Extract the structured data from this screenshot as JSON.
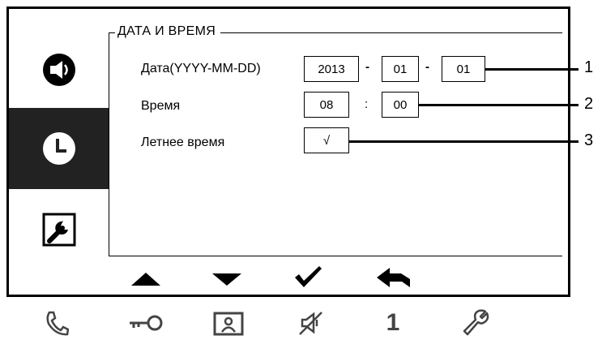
{
  "sidebar": {
    "items": [
      {
        "icon": "speaker-icon",
        "active": false
      },
      {
        "icon": "clock-icon",
        "active": true
      },
      {
        "icon": "wrench-icon",
        "active": false
      }
    ]
  },
  "panel": {
    "title": "ДАТА И ВРЕМЯ",
    "date_label": "Дата(YYYY-MM-DD)",
    "date_year": "2013",
    "date_sep1": "-",
    "date_month": "01",
    "date_sep2": "-",
    "date_day": "01",
    "time_label": "Время",
    "time_hour": "08",
    "time_sep": ":",
    "time_minute": "00",
    "dst_label": "Летнее время",
    "dst_value": "√"
  },
  "callouts": [
    "1",
    "2",
    "3"
  ],
  "toolbar": {
    "buttons": [
      {
        "icon": "arrow-up-icon"
      },
      {
        "icon": "arrow-down-icon"
      },
      {
        "icon": "checkmark-icon"
      },
      {
        "icon": "back-arrow-icon"
      }
    ]
  },
  "bottom_bar": {
    "icons": [
      "phone-icon",
      "key-icon",
      "contact-card-icon",
      "mute-icon",
      "one-digit",
      "wrench-outline-icon"
    ],
    "digit": "1"
  },
  "colors": {
    "active_sidebar": "#222222",
    "bottom_icons": "#444444"
  }
}
